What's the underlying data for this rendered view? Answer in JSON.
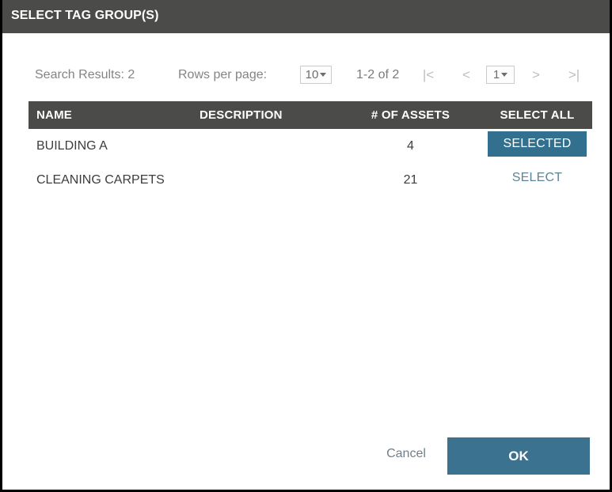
{
  "dialog": {
    "title": "SELECT TAG GROUP(S)"
  },
  "toolbar": {
    "search_results_label": "Search Results: 2",
    "rows_per_page_label": "Rows per page:",
    "rows_per_page_value": "10",
    "range_label": "1-2 of 2",
    "page_value": "1",
    "first_page_icon": "|<",
    "prev_page_icon": "<",
    "next_page_icon": ">",
    "last_page_icon": ">|"
  },
  "table": {
    "columns": [
      {
        "key": "name",
        "label": "NAME"
      },
      {
        "key": "description",
        "label": "DESCRIPTION"
      },
      {
        "key": "assets",
        "label": "# OF ASSETS"
      },
      {
        "key": "select",
        "label": "SELECT ALL"
      }
    ],
    "rows": [
      {
        "name": "BUILDING A",
        "description": "",
        "assets": "4",
        "action_label": "SELECTED",
        "selected": true
      },
      {
        "name": "CLEANING CARPETS",
        "description": "",
        "assets": "21",
        "action_label": "SELECT",
        "selected": false
      }
    ]
  },
  "footer": {
    "cancel_label": "Cancel",
    "ok_label": "OK"
  },
  "colors": {
    "header_bar": "#4b4b49",
    "accent_primary": "#3a7290",
    "accent_selected": "#33708f",
    "link_teal": "#5c8497",
    "border_outer": "#000000"
  }
}
